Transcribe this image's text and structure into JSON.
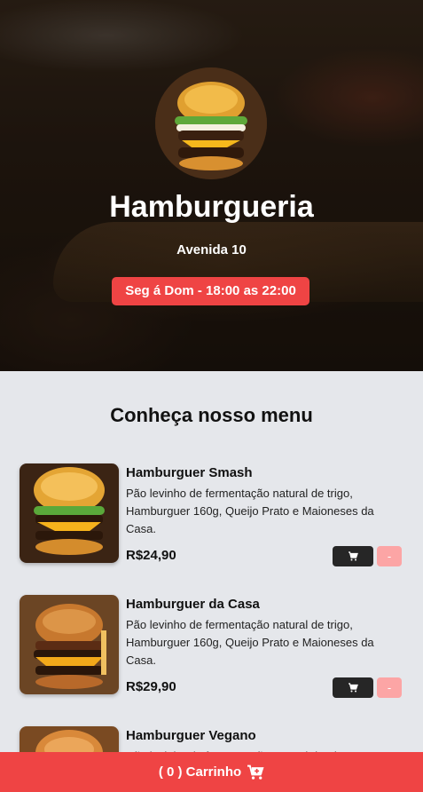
{
  "restaurant": {
    "name": "Hamburgueria",
    "address": "Avenida 10",
    "hours": "Seg á Dom - 18:00 as 22:00"
  },
  "menu": {
    "title": "Conheça nosso menu",
    "items": [
      {
        "name": "Hamburguer Smash",
        "description": "Pão levinho de fermentação natural de trigo, Hamburguer 160g, Queijo Prato e Maioneses da Casa.",
        "price": "R$24,90",
        "remove_label": "-"
      },
      {
        "name": "Hamburguer da Casa",
        "description": "Pão levinho de fermentação natural de trigo, Hamburguer 160g, Queijo Prato e Maioneses da Casa.",
        "price": "R$29,90",
        "remove_label": "-"
      },
      {
        "name": "Hamburguer Vegano",
        "description": "Pão levinho de fermentação natural de trigo",
        "price": "",
        "remove_label": "-"
      }
    ]
  },
  "cart": {
    "label": "( 0 ) Carrinho"
  },
  "icons": {
    "cart": "cart-icon",
    "cart_plus": "cart-plus-icon"
  },
  "colors": {
    "accent": "#ef4444",
    "accent_light": "#fca5a5",
    "dark_button": "#262626",
    "page_bg": "#e5e7eb"
  }
}
